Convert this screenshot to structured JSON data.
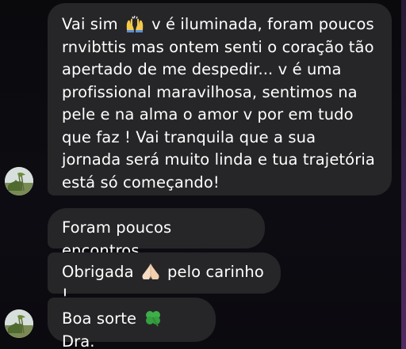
{
  "colors": {
    "background": "#0c0c0f",
    "bubble": "#262628",
    "text": "#ffffff"
  },
  "messages": [
    {
      "parts": [
        "Vai sim",
        "v é iluminada, foram poucos rnvibttis mas ontem senti o coração tão apertado de me despedir... v é uma profissional maravilhosa, sentimos na pele e na alma o amor v por em tudo que faz ! Vai tranquila que a sua jornada será muito linda e tua trajetória está só começando!"
      ],
      "emoji": "raising-hands-emoji"
    },
    {
      "parts": [
        "Foram poucos encontros"
      ]
    },
    {
      "parts": [
        "Obrigada",
        "pelo carinho !"
      ],
      "emoji": "folded-hands-emoji"
    },
    {
      "parts": [
        "Boa sorte",
        "Dra."
      ],
      "emoji": "four-leaf-clover-emoji"
    }
  ],
  "avatars": [
    "profile-avatar",
    "profile-avatar"
  ]
}
